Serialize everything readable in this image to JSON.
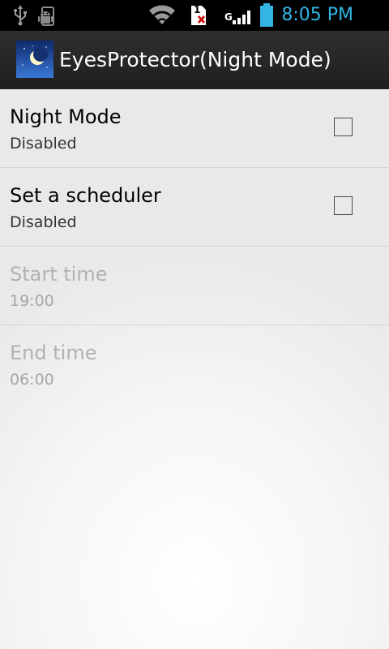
{
  "status_bar": {
    "time": "8:05 PM",
    "sim_label": "1",
    "network_label": "G",
    "accent_color": "#33b5e5",
    "icons": [
      "usb-icon",
      "android-debug-icon",
      "wifi-icon",
      "sim-error-icon",
      "signal-icon",
      "battery-icon"
    ]
  },
  "action_bar": {
    "title": "EyesProtector(Night Mode)",
    "icon": "night-moon-app-icon"
  },
  "preferences": [
    {
      "title": "Night Mode",
      "summary": "Disabled",
      "enabled": true,
      "has_checkbox": true,
      "checked": false
    },
    {
      "title": "Set a scheduler",
      "summary": "Disabled",
      "enabled": true,
      "has_checkbox": true,
      "checked": false
    },
    {
      "title": "Start time",
      "summary": "19:00",
      "enabled": false,
      "has_checkbox": false
    },
    {
      "title": "End time",
      "summary": "06:00",
      "enabled": false,
      "has_checkbox": false
    }
  ]
}
